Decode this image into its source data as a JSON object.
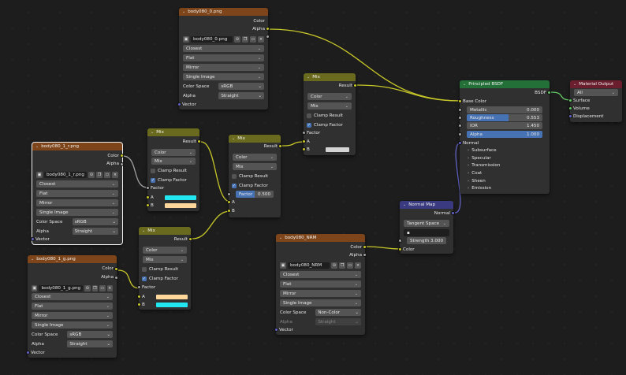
{
  "nodes": {
    "tex0": {
      "title": "body080_0.png",
      "outputs": [
        "Color",
        "Alpha"
      ],
      "image": "body080_0.png",
      "interp": "Closest",
      "proj": "Flat",
      "ext": "Mirror",
      "source": "Single Image",
      "cs_label": "Color Space",
      "cs": "sRGB",
      "alpha_label": "Alpha",
      "alpha": "Straight",
      "vector": "Vector"
    },
    "tex1r": {
      "title": "body080_1_r.png",
      "outputs": [
        "Color",
        "Alpha"
      ],
      "image": "body080_1_r.png",
      "interp": "Closest",
      "proj": "Flat",
      "ext": "Mirror",
      "source": "Single Image",
      "cs_label": "Color Space",
      "cs": "sRGB",
      "alpha_label": "Alpha",
      "alpha": "Straight",
      "vector": "Vector"
    },
    "tex1g": {
      "title": "body080_1_g.png",
      "outputs": [
        "Color",
        "Alpha"
      ],
      "image": "body080_1_g.png",
      "interp": "Closest",
      "proj": "Flat",
      "ext": "Mirror",
      "source": "Single Image",
      "cs_label": "Color Space",
      "cs": "sRGB",
      "alpha_label": "Alpha",
      "alpha": "Straight",
      "vector": "Vector"
    },
    "texnrm": {
      "title": "body080_NRM",
      "outputs": [
        "Color",
        "Alpha"
      ],
      "image": "body080_NRM",
      "interp": "Closest",
      "proj": "Flat",
      "ext": "Mirror",
      "source": "Single Image",
      "cs_label": "Color Space",
      "cs": "Non-Color",
      "alpha_label": "Alpha",
      "alpha": "Straight",
      "vector": "Vector"
    },
    "mix1": {
      "title": "Mix",
      "result": "Result",
      "type": "Color",
      "blend": "Mix",
      "clamp_result": "Clamp Result",
      "clamp_factor": "Clamp Factor",
      "factor": "Factor",
      "a": "A",
      "b": "B",
      "a_color": "#22e6f0",
      "b_color": "#ffd79a"
    },
    "mix2": {
      "title": "Mix",
      "result": "Result",
      "type": "Color",
      "blend": "Mix",
      "clamp_result": "Clamp Result",
      "clamp_factor": "Clamp Factor",
      "factor_label": "Factor",
      "factor_value": "0.500",
      "a": "A",
      "b": "B"
    },
    "mix3": {
      "title": "Mix",
      "result": "Result",
      "type": "Color",
      "blend": "Mix",
      "clamp_result": "Clamp Result",
      "clamp_factor": "Clamp Factor",
      "factor": "Factor",
      "a": "A",
      "b": "B",
      "a_color": "#ffd79a",
      "b_color": "#22e6f0"
    },
    "mix4": {
      "title": "Mix",
      "result": "Result",
      "type": "Color",
      "blend": "Mix",
      "clamp_result": "Clamp Result",
      "clamp_factor": "Clamp Factor",
      "factor": "Factor",
      "a": "A",
      "b": "B",
      "b_color": "#d4d4d4"
    },
    "bsdf": {
      "title": "Principled BSDF",
      "out": "BSDF",
      "base_color": "Base Color",
      "metallic_label": "Metallic",
      "metallic": "0.000",
      "rough_label": "Roughness",
      "rough": "0.553",
      "rough_fill": 0.553,
      "ior_label": "IOR",
      "ior": "1.450",
      "alpha_label": "Alpha",
      "alpha": "1.000",
      "normal": "Normal",
      "panels": [
        "Subsurface",
        "Specular",
        "Transmission",
        "Coat",
        "Sheen",
        "Emission"
      ]
    },
    "out": {
      "title": "Material Output",
      "target": "All",
      "surface": "Surface",
      "volume": "Volume",
      "displacement": "Displacement"
    },
    "nmap": {
      "title": "Normal Map",
      "out": "Normal",
      "space": "Tangent Space",
      "uv": "",
      "strength_label": "Strength",
      "strength": "3.000",
      "color": "Color"
    }
  },
  "colors": {
    "wire": "#c7c729",
    "wire_vec": "#6363c7",
    "wire_shader": "#63c763",
    "wire_grey": "#a1a1a1"
  }
}
